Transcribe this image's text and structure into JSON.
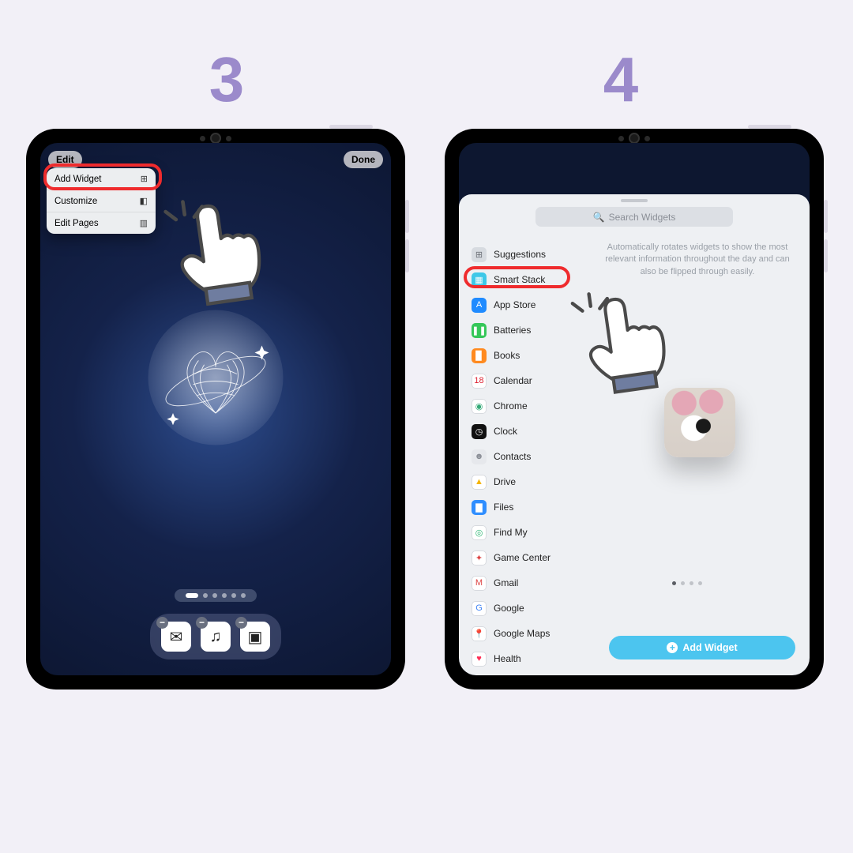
{
  "steps": {
    "left": "3",
    "right": "4"
  },
  "step3": {
    "edit_btn": "Edit",
    "done_btn": "Done",
    "menu": {
      "add_widget": "Add Widget",
      "customize": "Customize",
      "edit_pages": "Edit Pages"
    }
  },
  "step4": {
    "search_placeholder": "Search Widgets",
    "description": "Automatically rotates widgets to show the most relevant information throughout the day and can also be flipped through easily.",
    "add_widget_btn": "Add Widget",
    "apps": [
      {
        "label": "Suggestions",
        "icon": "⊞",
        "bg": "#d7dbe0",
        "fg": "#6c7077"
      },
      {
        "label": "Smart Stack",
        "icon": "▦",
        "bg": "#3ec8e8",
        "fg": "#ffffff"
      },
      {
        "label": "App Store",
        "icon": "A",
        "bg": "#1f8bff",
        "fg": "#ffffff"
      },
      {
        "label": "Batteries",
        "icon": "❚❚",
        "bg": "#35c759",
        "fg": "#ffffff"
      },
      {
        "label": "Books",
        "icon": "▉",
        "bg": "#ff8a1f",
        "fg": "#ffffff"
      },
      {
        "label": "Calendar",
        "icon": "18",
        "bg": "#ffffff",
        "fg": "#d23"
      },
      {
        "label": "Chrome",
        "icon": "◉",
        "bg": "#ffffff",
        "fg": "#3a7"
      },
      {
        "label": "Clock",
        "icon": "◷",
        "bg": "#111111",
        "fg": "#ffffff"
      },
      {
        "label": "Contacts",
        "icon": "☻",
        "bg": "#e6e8ec",
        "fg": "#8a8e96"
      },
      {
        "label": "Drive",
        "icon": "▲",
        "bg": "#ffffff",
        "fg": "#f4b400"
      },
      {
        "label": "Files",
        "icon": "▇",
        "bg": "#2f8eff",
        "fg": "#ffffff"
      },
      {
        "label": "Find My",
        "icon": "◎",
        "bg": "#ffffff",
        "fg": "#2bb673"
      },
      {
        "label": "Game Center",
        "icon": "✦",
        "bg": "#ffffff",
        "fg": "#d44"
      },
      {
        "label": "Gmail",
        "icon": "M",
        "bg": "#ffffff",
        "fg": "#d44"
      },
      {
        "label": "Google",
        "icon": "G",
        "bg": "#ffffff",
        "fg": "#4285f4"
      },
      {
        "label": "Google Maps",
        "icon": "📍",
        "bg": "#ffffff",
        "fg": "#d44"
      },
      {
        "label": "Health",
        "icon": "♥",
        "bg": "#ffffff",
        "fg": "#ff2d55"
      }
    ]
  }
}
